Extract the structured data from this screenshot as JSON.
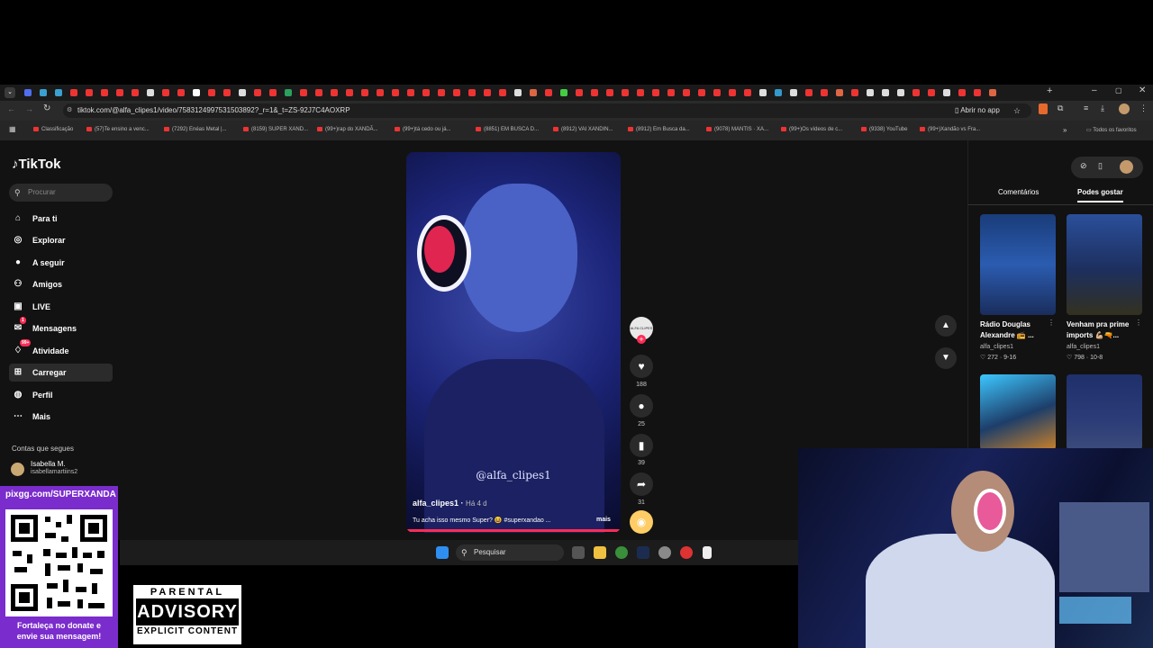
{
  "browser": {
    "url": "tiktok.com/@alfa_clipes1/video/7583124997531503892?_r=1&_t=ZS-92J7C4AOXRP",
    "open_in_app": "Abrir no app",
    "all_bookmarks": "Todos os favoritos",
    "bookmarks": [
      "Classificação",
      "(57)Te ensino a venc...",
      "(7292) Enéas Metal |...",
      "(8159) SUPER XAND...",
      "(99+)rap do XANDÃ...",
      "(99+)tá cedo ou já...",
      "(8851) EM BUSCA D...",
      "(8912) VAI XANDIN...",
      "(8912) Em Busca da...",
      "(9078) MANTIS · XA...",
      "(99+)Os vídeos de c...",
      "(9338) YouTube",
      "(99+)Xandão vs Fra..."
    ]
  },
  "tiktok": {
    "logo": "TikTok",
    "search_placeholder": "Procurar",
    "nav": [
      {
        "label": "Para ti",
        "icon": "home-icon"
      },
      {
        "label": "Explorar",
        "icon": "compass-icon"
      },
      {
        "label": "A seguir",
        "icon": "following-icon"
      },
      {
        "label": "Amigos",
        "icon": "friends-icon"
      },
      {
        "label": "LIVE",
        "icon": "live-icon"
      },
      {
        "label": "Mensagens",
        "icon": "messages-icon",
        "badge": "1"
      },
      {
        "label": "Atividade",
        "icon": "activity-icon",
        "badge": "99+"
      },
      {
        "label": "Carregar",
        "icon": "upload-icon"
      },
      {
        "label": "Perfil",
        "icon": "profile-avatar-icon"
      },
      {
        "label": "Mais",
        "icon": "more-icon"
      }
    ],
    "following_title": "Contas que segues",
    "following": {
      "name": "Isabella M.",
      "username": "isabellamartiins2"
    }
  },
  "video": {
    "watermark": "@alfa_clipes1",
    "username": "alfa_clipes1",
    "time": "Há 4 d",
    "caption": "Tu acha isso mesmo Super? 😆 #superxandao ...",
    "more": "mais",
    "avatar_text": "ALFA CLIPES",
    "likes": "188",
    "comments": "25",
    "saves": "39",
    "shares": "31"
  },
  "right_panel": {
    "tabs": [
      "Comentários",
      "Podes gostar"
    ],
    "active_tab": "Podes gostar",
    "cards": [
      {
        "title": "Rádio Douglas Alexandre 📻 ...",
        "user": "alfa_clipes1",
        "likes": "272",
        "date": "9-16"
      },
      {
        "title": "Venham pra prime imports 💪🏼🔫...",
        "user": "alfa_clipes1",
        "likes": "798",
        "date": "10-8"
      }
    ]
  },
  "taskbar": {
    "search": "Pesquisar"
  },
  "overlay": {
    "qr_url": "pixgg.com/SUPERXANDA",
    "qr_caption_1": "Fortaleça no donate e",
    "qr_caption_2": "envie sua mensagem!",
    "advisory_top": "PARENTAL",
    "advisory_mid": "ADVISORY",
    "advisory_bot": "EXPLICIT CONTENT"
  },
  "colors": {
    "accent": "#fe2c55",
    "donate": "#7a2ccc",
    "page_bg": "#121212"
  }
}
